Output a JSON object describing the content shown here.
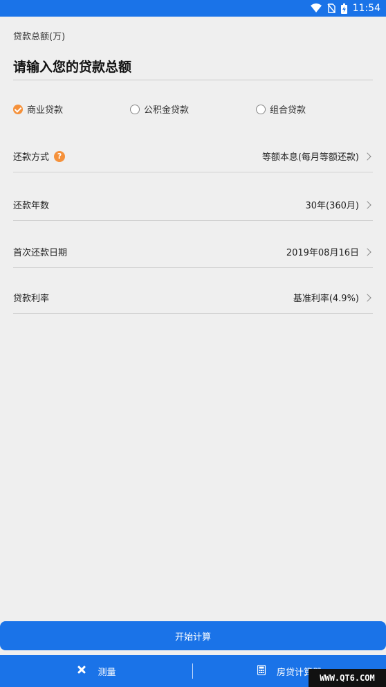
{
  "status_bar": {
    "time": "11:54"
  },
  "loan_amount": {
    "label": "贷款总额(万)",
    "placeholder": "请输入您的贷款总额",
    "value": ""
  },
  "loan_types": [
    {
      "label": "商业贷款",
      "checked": true
    },
    {
      "label": "公积金贷款",
      "checked": false
    },
    {
      "label": "组合贷款",
      "checked": false
    }
  ],
  "rows": {
    "repay_method": {
      "label": "还款方式",
      "value": "等额本息(每月等额还款)"
    },
    "repay_years": {
      "label": "还款年数",
      "value": "30年(360月)"
    },
    "first_date": {
      "label": "首次还款日期",
      "value": "2019年08月16日"
    },
    "rate": {
      "label": "贷款利率",
      "value": "基准利率(4.9%)"
    }
  },
  "calculate_button": "开始计算",
  "bottom_nav": [
    {
      "label": "测量",
      "icon": "tools-icon"
    },
    {
      "label": "房贷计算器",
      "icon": "calculator-icon"
    }
  ],
  "watermark": "WWW.QT6.COM",
  "colors": {
    "primary": "#1a73e8",
    "accent": "#f5913b"
  }
}
